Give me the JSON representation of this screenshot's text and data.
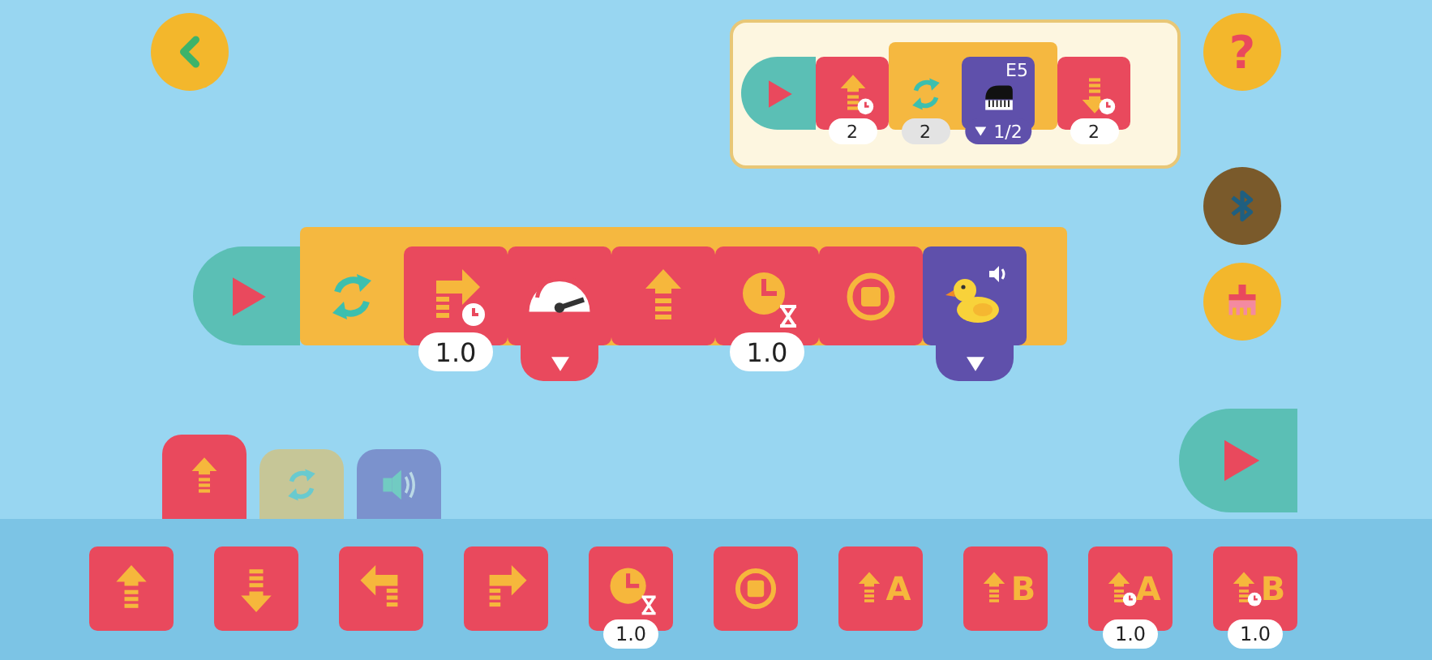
{
  "hint": {
    "blocks": [
      {
        "kind": "start"
      },
      {
        "kind": "up-timed",
        "value": "2"
      },
      {
        "kind": "loop",
        "value": "2",
        "children": [
          {
            "kind": "note",
            "label": "E5",
            "value": "1/2",
            "dropdown": true
          }
        ]
      },
      {
        "kind": "down-timed",
        "value": "2"
      }
    ]
  },
  "help_button": {
    "label": "?"
  },
  "bluetooth": {
    "connected": false
  },
  "program": {
    "blocks": [
      {
        "kind": "start"
      },
      {
        "kind": "loop",
        "children": [
          {
            "kind": "right-timed",
            "value": "1.0"
          },
          {
            "kind": "speed",
            "dropdown": true
          },
          {
            "kind": "up"
          },
          {
            "kind": "wait",
            "value": "1.0"
          },
          {
            "kind": "stop"
          },
          {
            "kind": "duck-sound",
            "dropdown": true
          }
        ]
      }
    ]
  },
  "category_tabs": [
    {
      "kind": "motion",
      "selected": true
    },
    {
      "kind": "control",
      "selected": false
    },
    {
      "kind": "sound",
      "selected": false
    }
  ],
  "palette": [
    {
      "kind": "up"
    },
    {
      "kind": "down"
    },
    {
      "kind": "left"
    },
    {
      "kind": "right"
    },
    {
      "kind": "wait",
      "value": "1.0"
    },
    {
      "kind": "stop"
    },
    {
      "kind": "up",
      "label": "A"
    },
    {
      "kind": "up",
      "label": "B"
    },
    {
      "kind": "up-timed",
      "label": "A",
      "value": "1.0"
    },
    {
      "kind": "up-timed",
      "label": "B",
      "value": "1.0"
    }
  ]
}
